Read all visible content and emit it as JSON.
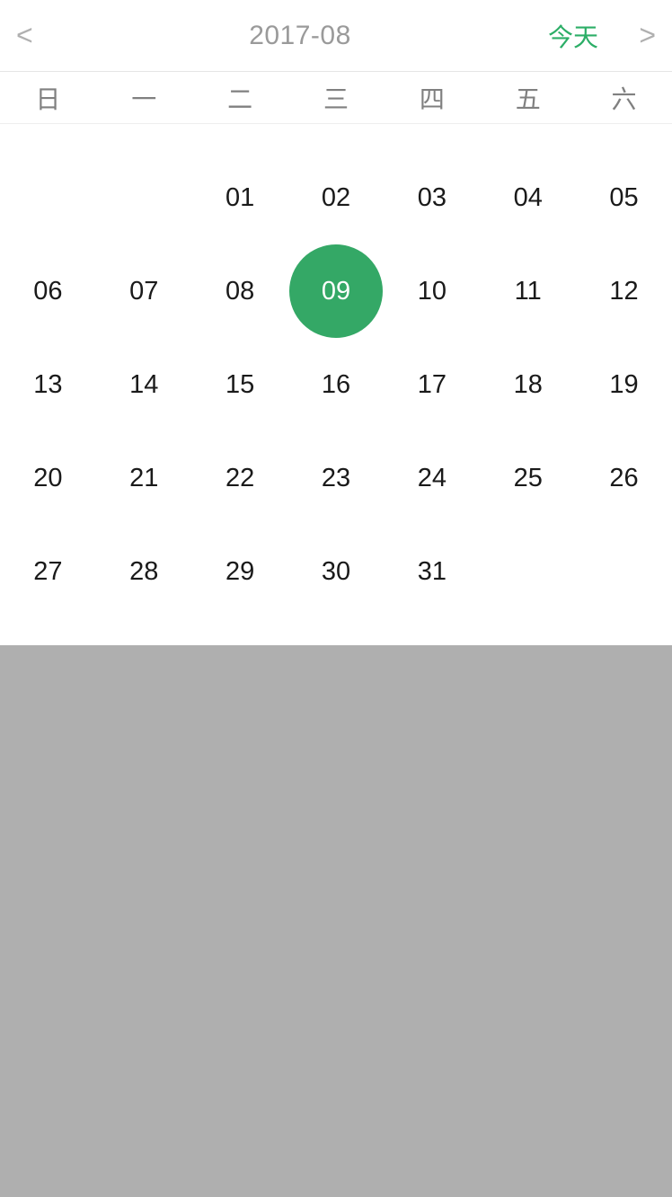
{
  "header": {
    "prev_label": "<",
    "next_label": ">",
    "title": "2017-08",
    "today_label": "今天"
  },
  "weekdays": [
    "日",
    "一",
    "二",
    "三",
    "四",
    "五",
    "六"
  ],
  "days": [
    {
      "label": "",
      "empty": true
    },
    {
      "label": "",
      "empty": true
    },
    {
      "label": "01"
    },
    {
      "label": "02"
    },
    {
      "label": "03"
    },
    {
      "label": "04"
    },
    {
      "label": "05"
    },
    {
      "label": "06"
    },
    {
      "label": "07"
    },
    {
      "label": "08"
    },
    {
      "label": "09",
      "selected": true
    },
    {
      "label": "10"
    },
    {
      "label": "11"
    },
    {
      "label": "12"
    },
    {
      "label": "13"
    },
    {
      "label": "14"
    },
    {
      "label": "15"
    },
    {
      "label": "16"
    },
    {
      "label": "17"
    },
    {
      "label": "18"
    },
    {
      "label": "19"
    },
    {
      "label": "20"
    },
    {
      "label": "21"
    },
    {
      "label": "22"
    },
    {
      "label": "23"
    },
    {
      "label": "24"
    },
    {
      "label": "25"
    },
    {
      "label": "26"
    },
    {
      "label": "27"
    },
    {
      "label": "28"
    },
    {
      "label": "29"
    },
    {
      "label": "30"
    },
    {
      "label": "31"
    }
  ],
  "colors": {
    "accent": "#34a866",
    "today_text": "#2cae67"
  }
}
